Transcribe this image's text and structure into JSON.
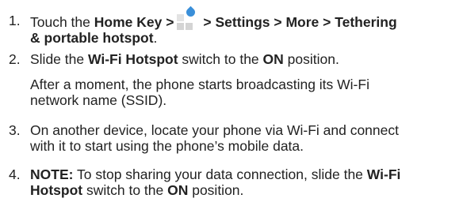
{
  "steps": [
    {
      "number": "1.",
      "seg": {
        "b1": "Touch the ",
        "home_key": "Home Key >",
        "settings_path": "> Settings > More > Tethering",
        "path_end": "& portable hotspot",
        "period": "."
      },
      "icon": "app-drawer-icon"
    },
    {
      "number": "2.",
      "seg": {
        "t1": "Slide the ",
        "wifi_hotspot": "Wi-Fi Hotspot",
        "t2": " switch to the ",
        "on": "ON",
        "t3": " position."
      },
      "note_line1": "After a moment, the phone starts broadcasting its Wi-Fi",
      "note_line2": "network name (SSID)."
    },
    {
      "number": "3.",
      "line1": "On another device, locate your phone via Wi-Fi and connect",
      "line2": "with it to start using the phone’s mobile data."
    },
    {
      "number": "4.",
      "seg": {
        "note_label": "NOTE:",
        "t1": " To stop sharing your data connection, slide the ",
        "wifi": "Wi-Fi",
        "hotspot": "Hotspot",
        "t2": " switch to the ",
        "on": "ON",
        "t3": " position."
      }
    }
  ]
}
